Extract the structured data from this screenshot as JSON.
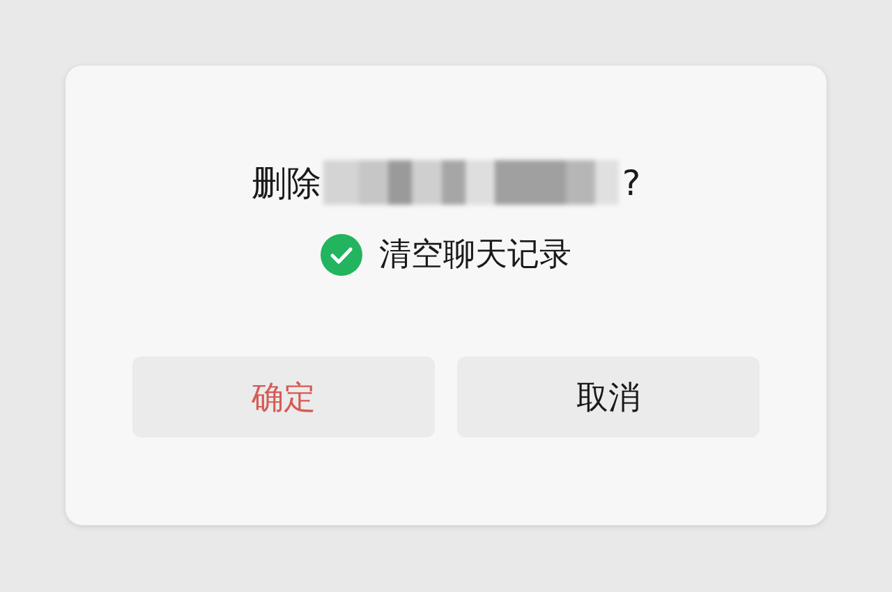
{
  "dialog": {
    "title_prefix": "删除",
    "title_suffix": "?",
    "name_hidden": true,
    "option": {
      "label": "清空聊天记录",
      "checked": true
    },
    "buttons": [
      {
        "label": "确定",
        "kind": "danger"
      },
      {
        "label": "取消",
        "kind": "normal"
      }
    ]
  }
}
